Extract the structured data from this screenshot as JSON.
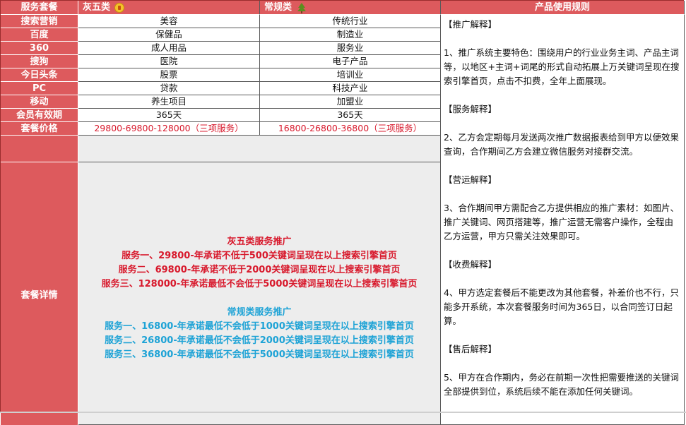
{
  "header": {
    "label": "服务套餐",
    "col_a": "灰五类",
    "col_b": "常规类",
    "col_rules": "产品使用规则",
    "col_a_icon": "gold-thumbs-badge-icon",
    "col_b_icon": "green-tree-icon"
  },
  "rows": [
    {
      "label": "搜索营销",
      "a": "美容",
      "b": "传统行业"
    },
    {
      "label": "百度",
      "a": "保健品",
      "b": "制造业"
    },
    {
      "label": "360",
      "a": "成人用品",
      "b": "服务业"
    },
    {
      "label": "搜狗",
      "a": "医院",
      "b": "电子产品"
    },
    {
      "label": "今日头条",
      "a": "股票",
      "b": "培训业"
    },
    {
      "label": "PC",
      "a": "贷款",
      "b": "科技产业"
    },
    {
      "label": "移动",
      "a": "养生项目",
      "b": "加盟业"
    },
    {
      "label": "会员有效期",
      "a": "365天",
      "b": "365天"
    },
    {
      "label": "套餐价格",
      "a": "29800-69800-128000（三项服务）",
      "b": "16800-26800-36800（三项服务）"
    }
  ],
  "detail": {
    "label": "套餐详情",
    "gray_title": "灰五类服务推广",
    "gray_lines": [
      "服务一、29800-年承诺不低于500关键词呈现在以上搜索引擎首页",
      "服务二、69800-年承诺不低于2000关键词呈现在以上搜索引擎首页",
      "服务三、128000-年承诺最低不会低于5000关键词呈现在以上搜索引擎首页"
    ],
    "regular_title": "常规类服务推广",
    "regular_lines": [
      "服务一、16800-年承诺最低不会低于1000关键词呈现在以上搜索引擎首页",
      "服务二、26800-年承诺最低不会低于2000关键词呈现在以上搜索引擎首页",
      "服务三、36800-年承诺最低不会低于5000关键词呈现在以上搜索引擎首页"
    ]
  },
  "rules": {
    "promo_title": "【推广解释】",
    "promo_text": "1、推广系统主要特色：围绕用户的行业业务主词、产品主词等，以地区+主词+词尾的形式自动拓展上万关键词呈现在搜索引擎首页，点击不扣费，全年上面展现。",
    "service_title": "【服务解释】",
    "service_text": "2、乙方会定期每月发送两次推广数据报表给到甲方以便效果查询，合作期间乙方会建立微信服务对接群交流。",
    "ops_title": "【营运解释】",
    "ops_text": "3、合作期间甲方需配合乙方提供相应的推广素材：如图片、推广关键词、网页搭建等，推广运营无需客户操作，全程由乙方运营，甲方只需关注效果即可。",
    "fee_title": "【收费解释】",
    "fee_text": "4、甲方选定套餐后不能更改为其他套餐，补差价也不行，只能多开系统，本次套餐服务时间为365日，以合同签订日起算。",
    "after_title": "【售后解释】",
    "after_text": "5、甲方在合作期内，务必在前期一次性把需要推送的关键词全部提供到位，系统后续不能在添加任何关键词。"
  },
  "colors": {
    "label_bg": "#dd5a5d",
    "price_red": "#d8192c",
    "detail_blue": "#1ea3d6",
    "detail_bg": "#ededed"
  }
}
